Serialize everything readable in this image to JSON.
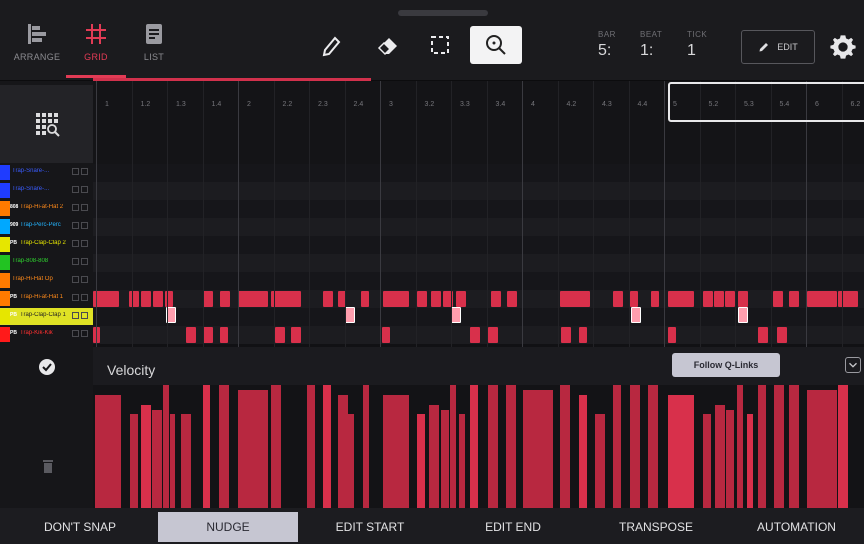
{
  "tabs": [
    {
      "label": "ARRANGE",
      "icon": "arrange-icon",
      "active": false
    },
    {
      "label": "GRID",
      "icon": "grid-hash-icon",
      "active": true
    },
    {
      "label": "LIST",
      "icon": "list-icon",
      "active": false
    }
  ],
  "tools": [
    {
      "icon": "pencil-icon",
      "active": false
    },
    {
      "icon": "eraser-icon",
      "active": false
    },
    {
      "icon": "select-marquee-icon",
      "active": false
    },
    {
      "icon": "zoom-icon",
      "active": true
    }
  ],
  "position": {
    "bar_label": "BAR",
    "bar_value": "5:",
    "beat_label": "BEAT",
    "beat_value": "1:",
    "tick_label": "TICK",
    "tick_value": "1"
  },
  "edit_button": {
    "label": "EDIT",
    "icon": "pencil-icon"
  },
  "settings_icon": "gear-icon",
  "ruler_labels": [
    "1",
    "1.2",
    "1.3",
    "1.4",
    "2",
    "2.2",
    "2.3",
    "2.4",
    "3",
    "3.2",
    "3.3",
    "3.4",
    "4",
    "4.2",
    "4.3",
    "4.4",
    "5",
    "5.2",
    "5.3",
    "5.4",
    "6",
    "6.2"
  ],
  "tracks": [
    {
      "name": "Trap-Snare-...",
      "color": "#1f3cff",
      "badge": "",
      "text_color": "#3a5cff"
    },
    {
      "name": "Trap-Snare-...",
      "color": "#1f3cff",
      "badge": "",
      "text_color": "#3a5cff"
    },
    {
      "name": "Trap-Hi-at-Hat 2",
      "color": "#ff7a00",
      "badge": "808",
      "text_color": "#ff8a1a"
    },
    {
      "name": "Trap-Perc-Perc",
      "color": "#00a8ff",
      "badge": "909",
      "text_color": "#24b5ff"
    },
    {
      "name": "Trap-Clap-Clap 2",
      "color": "#e6e600",
      "badge": "PB",
      "text_color": "#e6e600"
    },
    {
      "name": "Trap-808-808",
      "color": "#22c322",
      "badge": "",
      "text_color": "#2fd42f"
    },
    {
      "name": "Trap-Hi-Hat Op",
      "color": "#ff7a00",
      "badge": "",
      "text_color": "#ff8a1a"
    },
    {
      "name": "Trap-Hi-at-Hat 1",
      "color": "#ff7a00",
      "badge": "PB",
      "text_color": "#ff8a1a"
    },
    {
      "name": "Trap-Clap-Clap 1",
      "color": "#e6e600",
      "badge": "PB",
      "text_color": "#222222",
      "selected": true
    },
    {
      "name": "Trap-Kik-Kik",
      "color": "#ff1a1a",
      "badge": "PB",
      "text_color": "#ff3030"
    }
  ],
  "velocity": {
    "title": "Velocity",
    "follow_qlinks_label": "Follow Q-Links",
    "collapse_icon": "chevron-down-icon",
    "check_icon": "check-circle-icon",
    "trash_icon": "trash-icon"
  },
  "bottom_tabs": [
    {
      "label": "DON'T SNAP",
      "active": false
    },
    {
      "label": "NUDGE",
      "active": true
    },
    {
      "label": "EDIT START",
      "active": false
    },
    {
      "label": "EDIT END",
      "active": false
    },
    {
      "label": "TRANSPOSE",
      "active": false
    },
    {
      "label": "AUTOMATION",
      "active": false
    }
  ],
  "colors": {
    "accent": "#e23b55",
    "note": "#d8304b",
    "selected_note": "#ff9eae"
  }
}
